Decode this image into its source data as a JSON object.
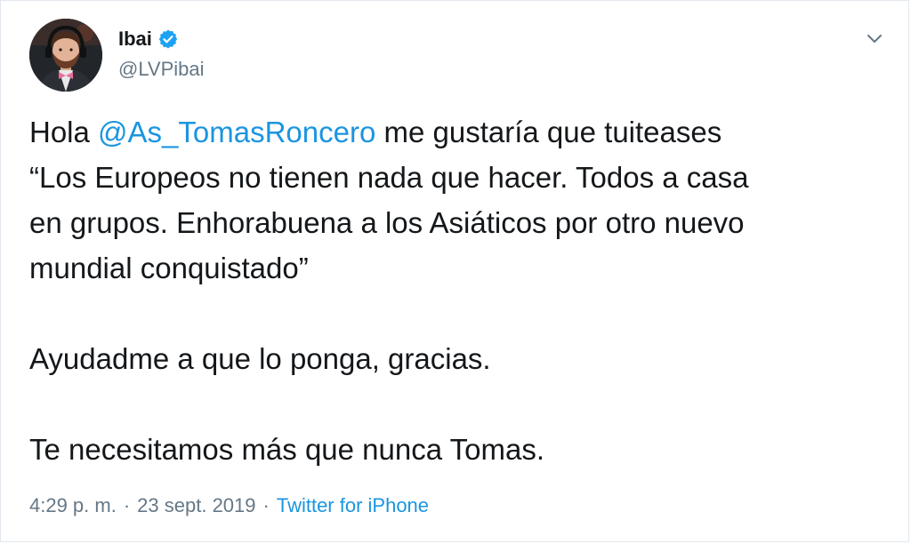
{
  "author": {
    "display_name": "Ibai",
    "handle": "@LVPibai",
    "verified": true,
    "verified_color": "#1da1f2"
  },
  "tweet": {
    "line1_prefix": "Hola ",
    "mention": "@As_TomasRoncero",
    "line1_suffix": " me gustaría que tuiteases",
    "quote_lines": [
      "“Los Europeos no tienen nada que hacer. Todos a casa",
      "en grupos. Enhorabuena a los Asiáticos por otro nuevo",
      "mundial conquistado”"
    ],
    "paragraph2": "Ayudadme a que lo ponga, gracias.",
    "paragraph3": "Te necesitamos más que nunca Tomas."
  },
  "meta": {
    "time": "4:29 p. m.",
    "date": "23 sept. 2019",
    "separator": "·",
    "source": "Twitter for iPhone"
  },
  "colors": {
    "link": "#1b95e0",
    "secondary_text": "#657786",
    "primary_text": "#14171a"
  },
  "icons": {
    "avatar": "avatar-image",
    "verified": "verified-badge-icon",
    "caret": "chevron-down-icon"
  }
}
